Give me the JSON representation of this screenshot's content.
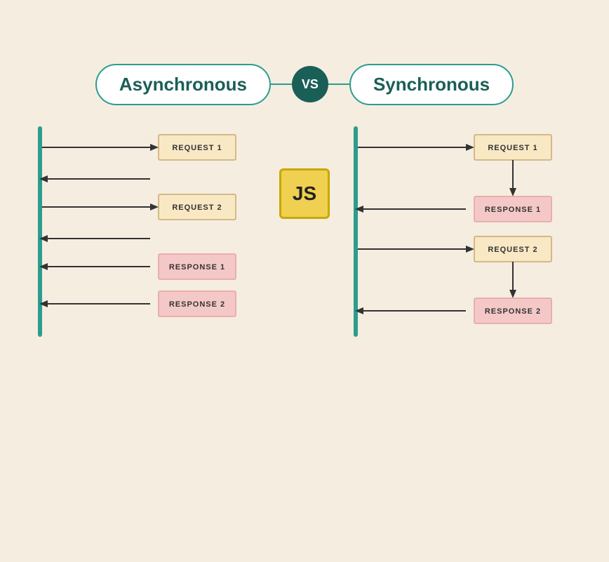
{
  "header": {
    "async_label": "Asynchronous",
    "vs_label": "VS",
    "sync_label": "Synchronous"
  },
  "js_badge": "JS",
  "async_diagram": {
    "items": [
      {
        "type": "request",
        "label": "REQUEST 1",
        "direction": "right"
      },
      {
        "type": "empty_back",
        "label": "",
        "direction": "left"
      },
      {
        "type": "request",
        "label": "REQUEST 2",
        "direction": "right"
      },
      {
        "type": "empty_back",
        "label": "",
        "direction": "left"
      },
      {
        "type": "response",
        "label": "RESPONSE 1",
        "direction": "left"
      },
      {
        "type": "response",
        "label": "RESPONSE 2",
        "direction": "left"
      }
    ]
  },
  "sync_diagram": {
    "items": [
      {
        "type": "request",
        "label": "REQUEST 1",
        "direction": "right"
      },
      {
        "type": "response",
        "label": "RESPONSE 1",
        "direction": "left"
      },
      {
        "type": "request",
        "label": "REQUEST 2",
        "direction": "right"
      },
      {
        "type": "response",
        "label": "RESPONSE 2",
        "direction": "left"
      }
    ]
  },
  "colors": {
    "background": "#f5ede0",
    "teal": "#2a9d8f",
    "dark_teal": "#1a5f57",
    "request_bg": "#f9e8c4",
    "request_border": "#c8a96e",
    "response_bg": "#f5c8c8",
    "response_border": "#e5a0a0",
    "js_bg": "#f0d050",
    "arrow": "#333333"
  }
}
